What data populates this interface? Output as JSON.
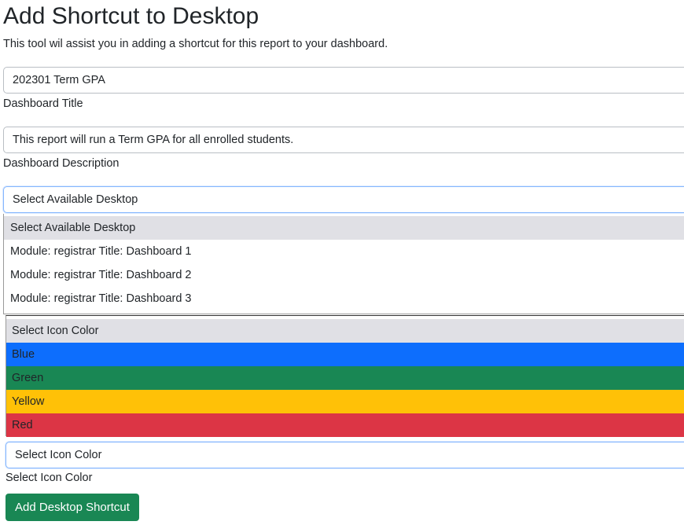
{
  "header": {
    "title": "Add Shortcut to Desktop",
    "subtitle": "This tool wil assist you in adding a shortcut for this report to your dashboard."
  },
  "form": {
    "dashboard_title": {
      "value": "202301 Term GPA",
      "label": "Dashboard Title"
    },
    "dashboard_description": {
      "value": "This report will run a Term GPA for all enrolled students.",
      "label": "Dashboard Description"
    },
    "desktop_select": {
      "selected": "Select Available Desktop",
      "options": [
        "Select Available Desktop",
        "Module: registrar Title: Dashboard 1",
        "Module: registrar Title: Dashboard 2",
        "Module: registrar Title: Dashboard 3"
      ]
    },
    "icon_color_select": {
      "selected": "Select Icon Color",
      "label": "Select Icon Color",
      "options": [
        {
          "label": "Select Icon Color",
          "bg": "#e0e0e5"
        },
        {
          "label": "Blue",
          "bg": "#0d6efd"
        },
        {
          "label": "Green",
          "bg": "#198754"
        },
        {
          "label": "Yellow",
          "bg": "#ffc107"
        },
        {
          "label": "Red",
          "bg": "#dc3545"
        }
      ]
    },
    "submit_label": "Add Desktop Shortcut",
    "submit_color": "#198754"
  }
}
